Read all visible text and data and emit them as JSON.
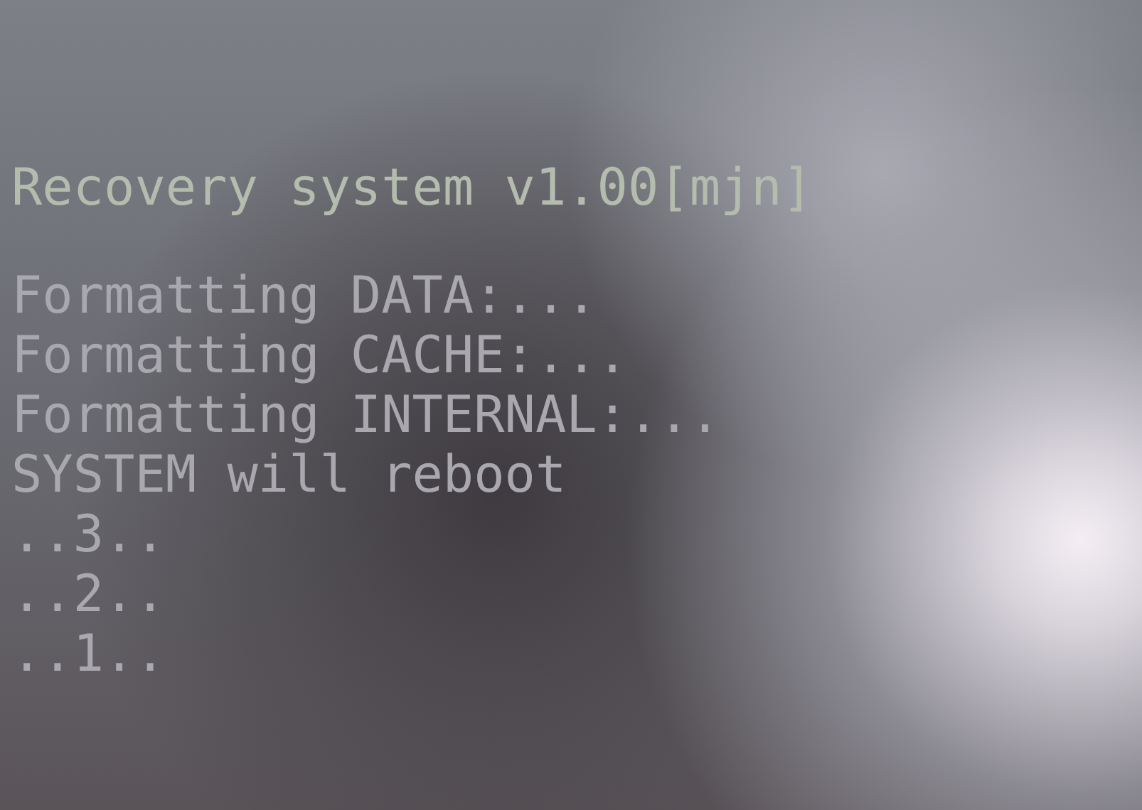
{
  "screen": {
    "title": "Recovery system v1.00[mjn]",
    "lines": [
      "Formatting DATA:...",
      "Formatting CACHE:...",
      "Formatting INTERNAL:...",
      "SYSTEM will reboot",
      "..3..",
      "..2..",
      "..1.."
    ]
  }
}
